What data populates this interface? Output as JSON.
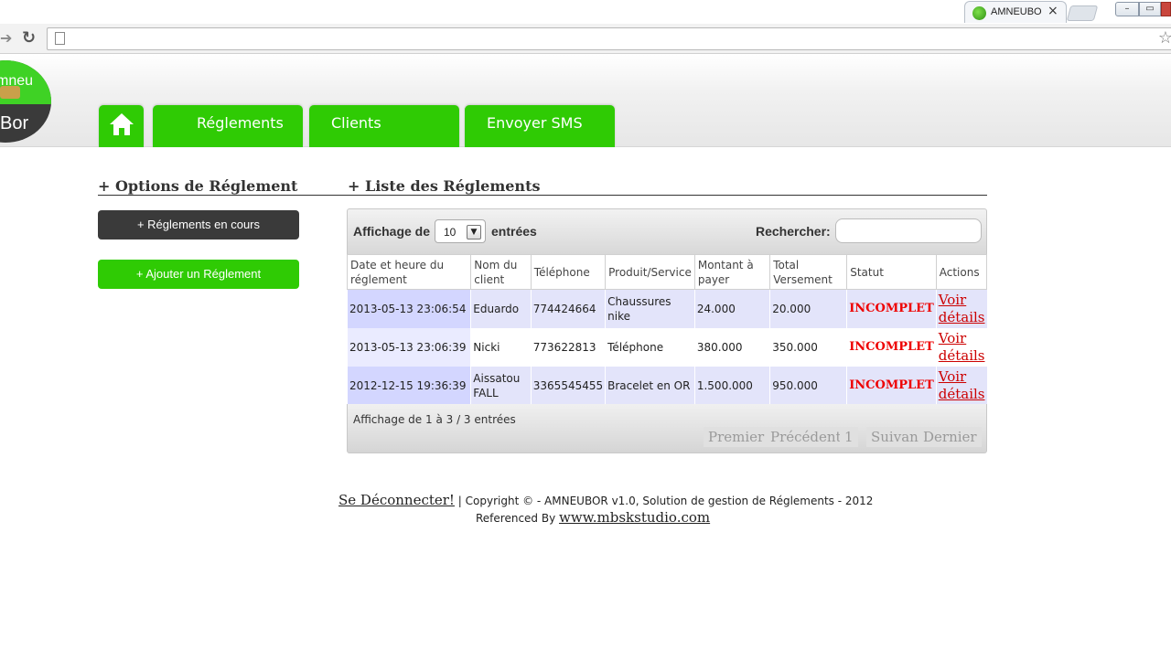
{
  "browser": {
    "tab_title": "AMNEUBOR",
    "tab_close": "×"
  },
  "header": {
    "logo_line1": "mneu",
    "logo_line2": "Bor",
    "nav": [
      "Réglements",
      "Clients",
      "Envoyer SMS"
    ]
  },
  "sidebar": {
    "title": "+ Options de Réglement",
    "buttons": [
      "+ Réglements en cours",
      "+ Ajouter un Réglement"
    ]
  },
  "list": {
    "title": "+ Liste des Réglements",
    "length_prefix": "Affichage de",
    "length_value": "10",
    "length_suffix": "entrées",
    "search_label": "Rechercher:",
    "search_value": "",
    "columns": [
      "Date et heure du réglement",
      "Nom du client",
      "Téléphone",
      "Produit/Service",
      "Montant à payer",
      "Total Versement",
      "Statut",
      "Actions"
    ],
    "rows": [
      {
        "date": "2013-05-13 23:06:54",
        "client": "Eduardo",
        "phone": "774424664",
        "product": "Chaussures nike",
        "amount": "24.000",
        "paid": "20.000",
        "status": "INCOMPLET",
        "action": "Voir détails"
      },
      {
        "date": "2013-05-13 23:06:39",
        "client": "Nicki",
        "phone": "773622813",
        "product": "Téléphone",
        "amount": "380.000",
        "paid": "350.000",
        "status": "INCOMPLET",
        "action": "Voir détails"
      },
      {
        "date": "2012-12-15 19:36:39",
        "client": "Aissatou FALL",
        "phone": "3365545455",
        "product": "Bracelet en OR",
        "amount": "1.500.000",
        "paid": "950.000",
        "status": "INCOMPLET",
        "action": "Voir détails"
      }
    ],
    "info": "Affichage de 1 à 3 / 3 entrées",
    "pager": {
      "first": "Premier",
      "prev": "Précédent",
      "page": "1",
      "next": "Suivant",
      "last": "Dernier"
    }
  },
  "footer": {
    "logout": "Se Déconnecter!",
    "copyright": " | Copyright © - AMNEUBOR v1.0, Solution de gestion de Réglements - 2012",
    "referenced": "Referenced By ",
    "site": "www.mbskstudio.com"
  },
  "colors": {
    "accent": "#2fcb04",
    "dark_button": "#3a3a3a",
    "status": "#e00000"
  }
}
